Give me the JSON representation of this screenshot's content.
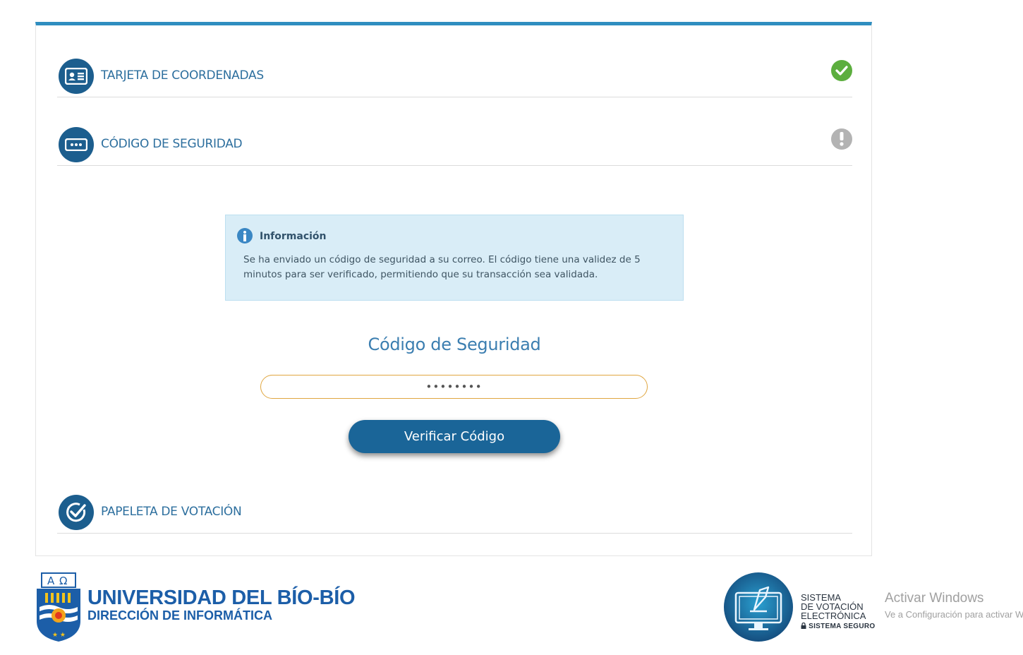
{
  "steps": [
    {
      "label": "TARJETA DE COORDENADAS",
      "icon": "id-card-icon",
      "status": "completed",
      "status_color": "#5cae3e"
    },
    {
      "label": "CÓDIGO DE SEGURIDAD",
      "icon": "password-dots-icon",
      "status": "pending",
      "status_color": "#b3b3b3"
    },
    {
      "label": "PAPELETA DE VOTACIÓN",
      "icon": "ballot-check-icon"
    }
  ],
  "info": {
    "title": "Información",
    "message": "Se ha enviado un código de seguridad a su correo. El código tiene una validez de 5 minutos para ser verificado, permitiendo que su transacción sea validada."
  },
  "security_code": {
    "heading": "Código de Seguridad",
    "value": "••••••••",
    "button_label": "Verificar Código"
  },
  "footer": {
    "university_name": "UNIVERSIDAD DEL BÍO-BÍO",
    "department": "DIRECCIÓN DE INFORMÁTICA",
    "system_lines": [
      "SISTEMA",
      "DE VOTACIÓN",
      "ELECTRÓNICA"
    ],
    "system_secure": "SISTEMA SEGURO"
  },
  "windows_watermark": {
    "title": "Activar Windows",
    "subtitle": "Ve a Configuración para activar Windows."
  },
  "colors": {
    "primary": "#1a6598",
    "accent_border": "#2f8ec0",
    "success": "#5cae3e",
    "pending": "#b3b3b3",
    "info_bg": "#d9edf7",
    "input_border": "#e0a640"
  }
}
